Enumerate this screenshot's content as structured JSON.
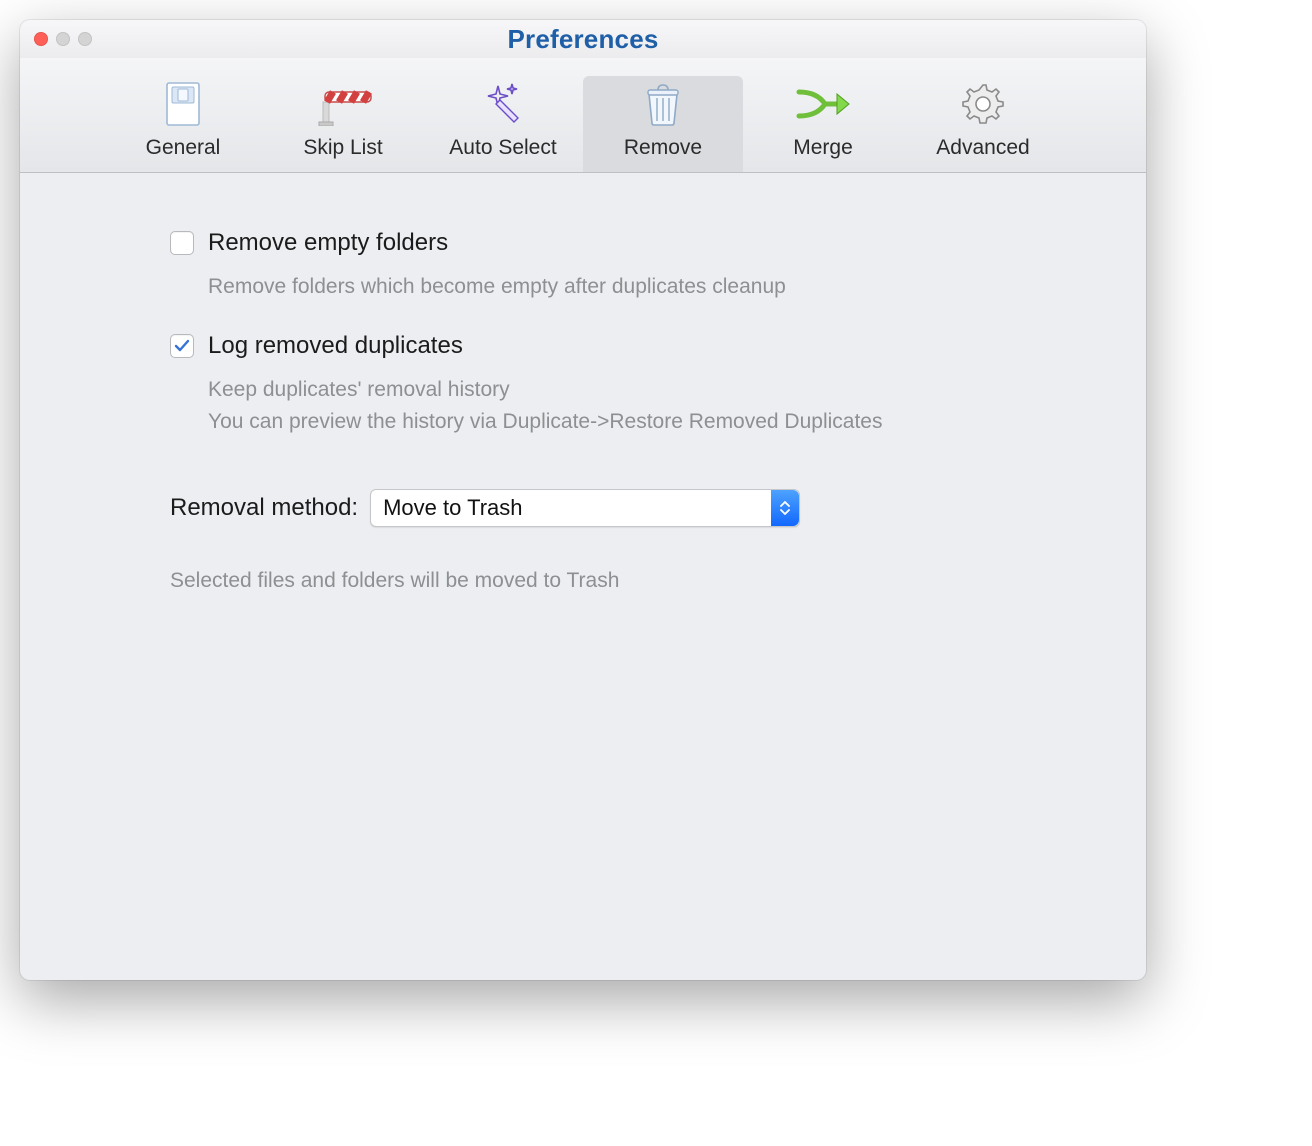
{
  "window": {
    "title": "Preferences"
  },
  "tabs": [
    {
      "label": "General"
    },
    {
      "label": "Skip List"
    },
    {
      "label": "Auto Select"
    },
    {
      "label": "Remove"
    },
    {
      "label": "Merge"
    },
    {
      "label": "Advanced"
    }
  ],
  "options": {
    "remove_empty": {
      "label": "Remove empty folders",
      "checked": false,
      "desc": "Remove folders which become empty after duplicates cleanup"
    },
    "log_removed": {
      "label": "Log removed duplicates",
      "checked": true,
      "desc_line1": "Keep duplicates' removal history",
      "desc_line2": "You can preview the history via Duplicate->Restore Removed Duplicates"
    }
  },
  "removal": {
    "label": "Removal method:",
    "selected": "Move to Trash",
    "desc": "Selected files and folders will be moved to Trash"
  }
}
